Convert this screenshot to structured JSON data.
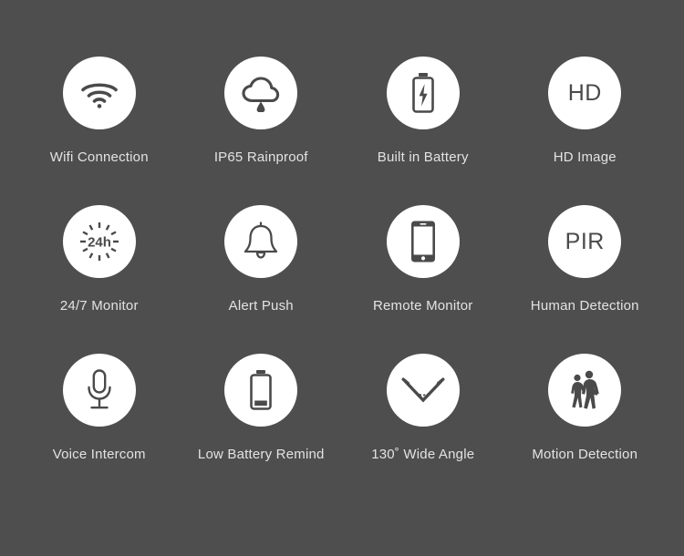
{
  "page": {
    "background_color": "#4e4e4e",
    "circle_color": "#ffffff",
    "icon_color": "#4a4a4a",
    "label_color": "#e3e3e3"
  },
  "features": [
    {
      "label": "Wifi Connection",
      "icon": "wifi-icon"
    },
    {
      "label": "IP65 Rainproof",
      "icon": "rain-cloud-icon"
    },
    {
      "label": "Built in Battery",
      "icon": "battery-charging-icon"
    },
    {
      "label": "HD Image",
      "icon": "hd-text-icon",
      "icon_text": "HD"
    },
    {
      "label": "24/7 Monitor",
      "icon": "twenty-four-hour-icon",
      "icon_text": "24h"
    },
    {
      "label": "Alert Push",
      "icon": "bell-icon"
    },
    {
      "label": "Remote Monitor",
      "icon": "smartphone-icon"
    },
    {
      "label": "Human Detection",
      "icon": "pir-text-icon",
      "icon_text": "PIR"
    },
    {
      "label": "Voice Intercom",
      "icon": "microphone-icon"
    },
    {
      "label": "Low Battery Remind",
      "icon": "low-battery-icon"
    },
    {
      "label": "130˚ Wide Angle",
      "icon": "wide-angle-icon"
    },
    {
      "label": "Motion Detection",
      "icon": "walking-people-icon"
    }
  ]
}
